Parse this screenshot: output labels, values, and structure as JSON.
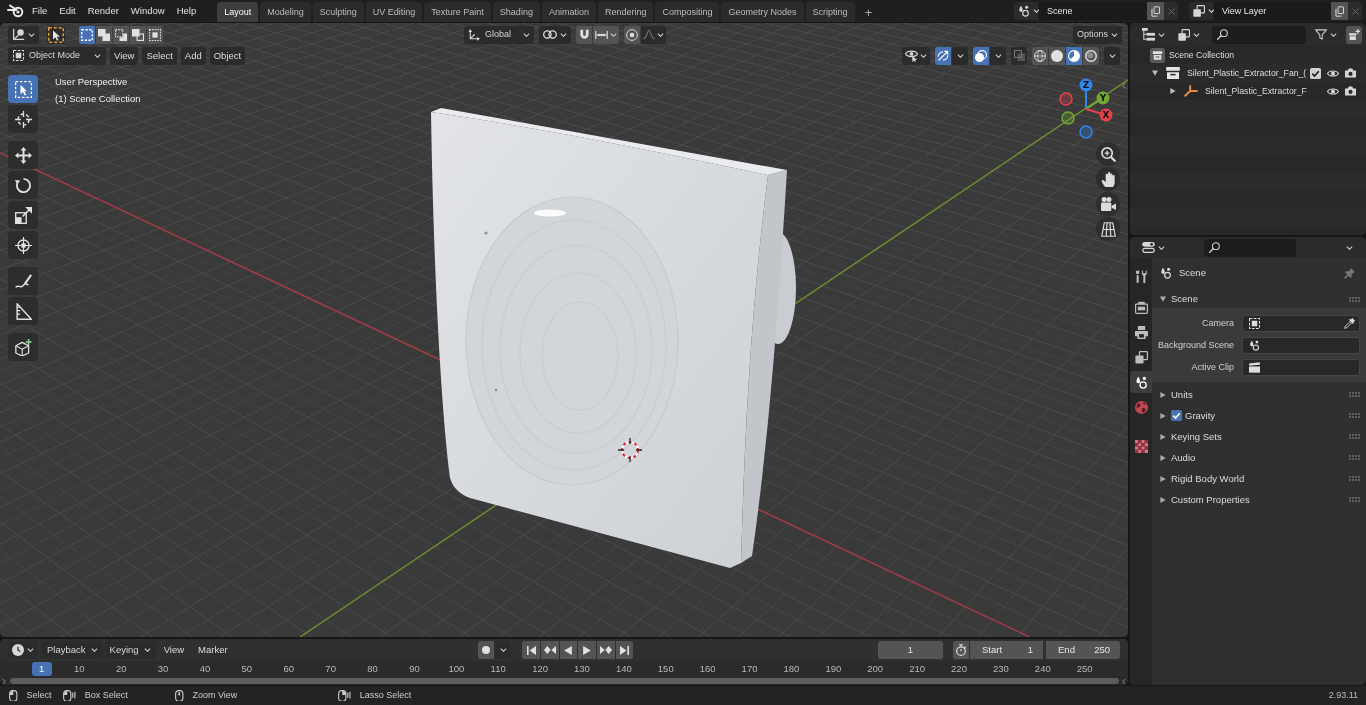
{
  "topbar": {
    "menus": [
      "File",
      "Edit",
      "Render",
      "Window",
      "Help"
    ],
    "workspaces": [
      {
        "label": "Layout",
        "selected": true
      },
      {
        "label": "Modeling",
        "selected": false
      },
      {
        "label": "Sculpting",
        "selected": false
      },
      {
        "label": "UV Editing",
        "selected": false
      },
      {
        "label": "Texture Paint",
        "selected": false
      },
      {
        "label": "Shading",
        "selected": false
      },
      {
        "label": "Animation",
        "selected": false
      },
      {
        "label": "Rendering",
        "selected": false
      },
      {
        "label": "Compositing",
        "selected": false
      },
      {
        "label": "Geometry Nodes",
        "selected": false
      },
      {
        "label": "Scripting",
        "selected": false
      }
    ],
    "add_workspace": "+",
    "scene": "Scene",
    "view_layer": "View Layer"
  },
  "viewport": {
    "header": {
      "select_modes": [
        {
          "kind": "set",
          "selected": true
        },
        {
          "kind": "extend",
          "selected": false
        },
        {
          "kind": "subtract",
          "selected": false
        },
        {
          "kind": "invert",
          "selected": false
        },
        {
          "kind": "intersect",
          "selected": false
        }
      ],
      "orientation": "Global",
      "options": "Options",
      "mode": "Object Mode",
      "menus": [
        "View",
        "Select",
        "Add",
        "Object"
      ],
      "gizmos": {
        "on": true
      },
      "overlays": {
        "on": true
      },
      "xray": {
        "on": false
      },
      "shading": [
        {
          "kind": "wireframe",
          "selected": false
        },
        {
          "kind": "solid",
          "selected": false
        },
        {
          "kind": "material",
          "selected": true
        },
        {
          "kind": "rendered",
          "selected": false
        }
      ]
    },
    "tool_groups": [
      [
        {
          "kind": "select",
          "selected": true
        },
        {
          "kind": "cursor",
          "selected": false
        }
      ],
      [
        {
          "kind": "move",
          "selected": false
        },
        {
          "kind": "rotate",
          "selected": false
        },
        {
          "kind": "scale",
          "selected": false
        },
        {
          "kind": "transform",
          "selected": false
        }
      ],
      [
        {
          "kind": "annotate",
          "selected": false
        },
        {
          "kind": "measure",
          "selected": false
        }
      ],
      [
        {
          "kind": "addcube",
          "selected": false
        }
      ]
    ],
    "info": [
      "User Perspective",
      "(1) Scene Collection"
    ],
    "gizmo_axes": [
      {
        "label": "Z",
        "color": "#2f86ec"
      },
      {
        "label": "Y",
        "color": "#71a834"
      },
      {
        "label": "X",
        "color": "#e5404d"
      }
    ]
  },
  "timeline": {
    "menus": [
      {
        "label": "Playback",
        "kind": "dropdown"
      },
      {
        "label": "Keying",
        "kind": "dropdown"
      },
      {
        "label": "View",
        "kind": "menu"
      },
      {
        "label": "Marker",
        "kind": "menu"
      }
    ],
    "current_frame": "1",
    "start": {
      "label": "Start",
      "value": "1"
    },
    "end": {
      "label": "End",
      "value": "250"
    },
    "ruler": {
      "current": "1",
      "ticks": [
        "10",
        "20",
        "30",
        "40",
        "50",
        "60",
        "70",
        "80",
        "90",
        "100",
        "110",
        "120",
        "130",
        "140",
        "150",
        "160",
        "170",
        "180",
        "190",
        "200",
        "210",
        "220",
        "230",
        "240",
        "250"
      ]
    }
  },
  "outliner": {
    "tree": [
      {
        "label": "Scene Collection",
        "kind": "root",
        "children": [
          {
            "label": "Silent_Plastic_Extractor_Fan_(",
            "kind": "collection",
            "expanded": true,
            "checked": true,
            "children": [
              {
                "label": "Silent_Plastic_Extractor_F",
                "kind": "empty",
                "expanded": false
              }
            ]
          }
        ]
      }
    ]
  },
  "properties": {
    "tab_groups": [
      [
        {
          "kind": "tool",
          "selected": false
        }
      ],
      [
        {
          "kind": "render",
          "selected": false
        },
        {
          "kind": "output",
          "selected": false
        },
        {
          "kind": "viewlayer",
          "selected": false
        },
        {
          "kind": "scene",
          "selected": true
        },
        {
          "kind": "world",
          "selected": false
        }
      ],
      [
        {
          "kind": "texture",
          "selected": false
        }
      ]
    ],
    "context": "Scene",
    "panels": [
      {
        "title": "Scene",
        "expanded": true,
        "fields": [
          {
            "label": "Camera",
            "kind": "object"
          },
          {
            "label": "Background Scene",
            "kind": "scene"
          },
          {
            "label": "Active Clip",
            "kind": "clip"
          }
        ]
      },
      {
        "title": "Units",
        "expanded": false
      },
      {
        "title": "Gravity",
        "expanded": false,
        "checked": true
      },
      {
        "title": "Keying Sets",
        "expanded": false
      },
      {
        "title": "Audio",
        "expanded": false
      },
      {
        "title": "Rigid Body World",
        "expanded": false
      },
      {
        "title": "Custom Properties",
        "expanded": false
      }
    ]
  },
  "status_bar": {
    "hints": [
      {
        "label": "Select",
        "kind": "click"
      },
      {
        "label": "Box Select",
        "kind": "drag"
      },
      {
        "label": "Zoom View",
        "kind": "middle"
      },
      {
        "label": "Lasso Select",
        "kind": "rightdrag"
      }
    ],
    "version": "2.93.11"
  }
}
